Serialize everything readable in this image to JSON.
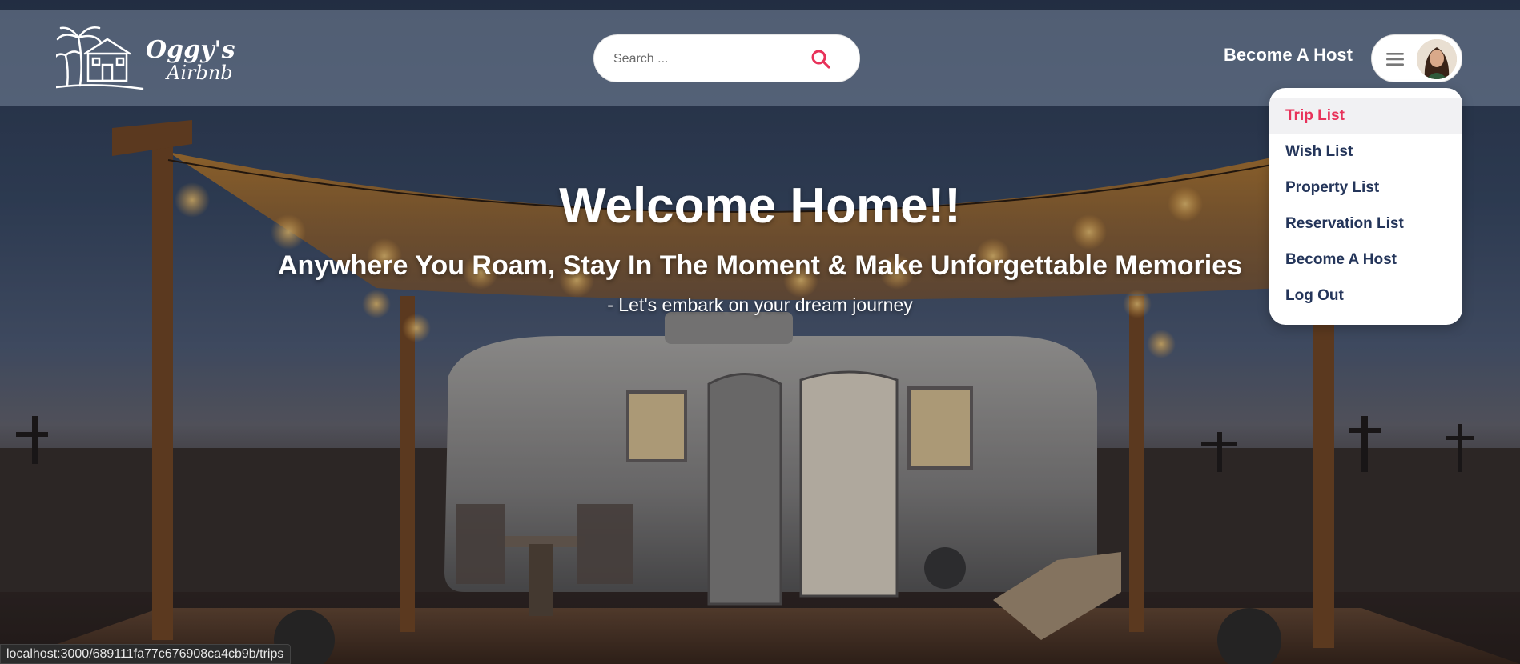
{
  "header": {
    "logo": {
      "line1": "Oggy's",
      "line2": "Airbnb"
    },
    "search": {
      "placeholder": "Search ...",
      "value": ""
    },
    "become_host_label": "Become A Host",
    "menu_icon": "hamburger-icon",
    "avatar_icon": "user-avatar"
  },
  "dropdown": {
    "items": [
      {
        "label": "Trip List",
        "active": true
      },
      {
        "label": "Wish List",
        "active": false
      },
      {
        "label": "Property List",
        "active": false
      },
      {
        "label": "Reservation List",
        "active": false
      },
      {
        "label": "Become A Host",
        "active": false
      },
      {
        "label": "Log Out",
        "active": false
      }
    ]
  },
  "hero": {
    "title": "Welcome Home!!",
    "subtitle": "Anywhere You Roam, Stay In The Moment & Make Unforgettable Memories",
    "tagline": "- Let's embark on your dream journey"
  },
  "status_bar": {
    "url": "localhost:3000/689111fa77c676908ca4cb9b/trips"
  },
  "colors": {
    "accent": "#e8325a",
    "menu_text": "#24355a",
    "header_overlay": "rgba(120,134,156,0.55)"
  }
}
